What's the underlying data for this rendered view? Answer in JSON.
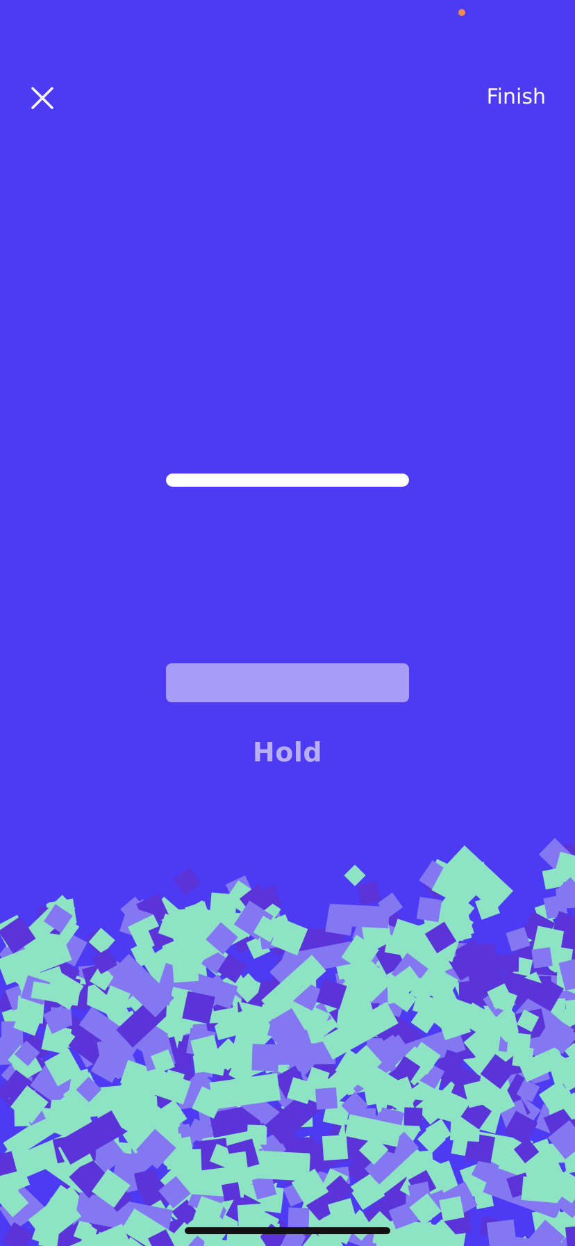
{
  "header": {
    "close_icon": "close-x-icon",
    "finish_label": "Finish"
  },
  "progress": {
    "fraction": 1.0
  },
  "hold": {
    "label": "Hold"
  },
  "colors": {
    "background": "#4c3af5",
    "progress_fill": "#ffffff",
    "hold_pad": "#a79cf7",
    "hold_label": "#b9aef8",
    "block_mint": "#8ee3c5",
    "block_lavender": "#8478f2",
    "block_violet": "#5a34d8",
    "status_dot": "#f08b4b"
  }
}
